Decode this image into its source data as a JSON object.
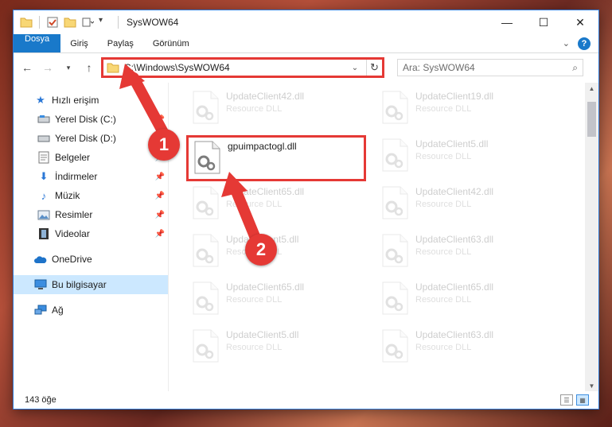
{
  "window": {
    "title": "SysWOW64"
  },
  "ribbon": {
    "tabs": [
      "Dosya",
      "Giriş",
      "Paylaş",
      "Görünüm"
    ]
  },
  "address": {
    "path": "C:\\Windows\\SysWOW64"
  },
  "search": {
    "placeholder": "Ara: SysWOW64"
  },
  "sidebar": {
    "quick_access": "Hızlı erişim",
    "items": [
      {
        "label": "Yerel Disk (C:)",
        "pinned": true
      },
      {
        "label": "Yerel Disk (D:)",
        "pinned": false
      },
      {
        "label": "Belgeler",
        "pinned": true
      },
      {
        "label": "İndirmeler",
        "pinned": true
      },
      {
        "label": "Müzik",
        "pinned": true
      },
      {
        "label": "Resimler",
        "pinned": true
      },
      {
        "label": "Videolar",
        "pinned": true
      }
    ],
    "onedrive": "OneDrive",
    "this_pc": "Bu bilgisayar",
    "network": "Ağ"
  },
  "files": [
    {
      "name": "UpdateClient42.dll",
      "desc": "Resource DLL",
      "highlight": false
    },
    {
      "name": "UpdateClient19.dll",
      "desc": "Resource DLL",
      "highlight": false
    },
    {
      "name": "gpuimpactogl.dll",
      "desc": "",
      "highlight": true
    },
    {
      "name": "UpdateClient5.dll",
      "desc": "Resource DLL",
      "highlight": false
    },
    {
      "name": "UpdateClient65.dll",
      "desc": "Resource DLL",
      "highlight": false
    },
    {
      "name": "UpdateClient42.dll",
      "desc": "Resource DLL",
      "highlight": false
    },
    {
      "name": "UpdateClient5.dll",
      "desc": "Resource DLL",
      "highlight": false
    },
    {
      "name": "UpdateClient63.dll",
      "desc": "Resource DLL",
      "highlight": false
    },
    {
      "name": "UpdateClient65.dll",
      "desc": "Resource DLL",
      "highlight": false
    },
    {
      "name": "UpdateClient65.dll",
      "desc": "Resource DLL",
      "highlight": false
    },
    {
      "name": "UpdateClient5.dll",
      "desc": "Resource DLL",
      "highlight": false
    },
    {
      "name": "UpdateClient63.dll",
      "desc": "Resource DLL",
      "highlight": false
    }
  ],
  "status": {
    "count": "143 öğe"
  },
  "annotations": {
    "step1": "1",
    "step2": "2"
  },
  "colors": {
    "accent": "#1979ca",
    "annotation": "#e53935",
    "selected": "#cce8ff"
  }
}
